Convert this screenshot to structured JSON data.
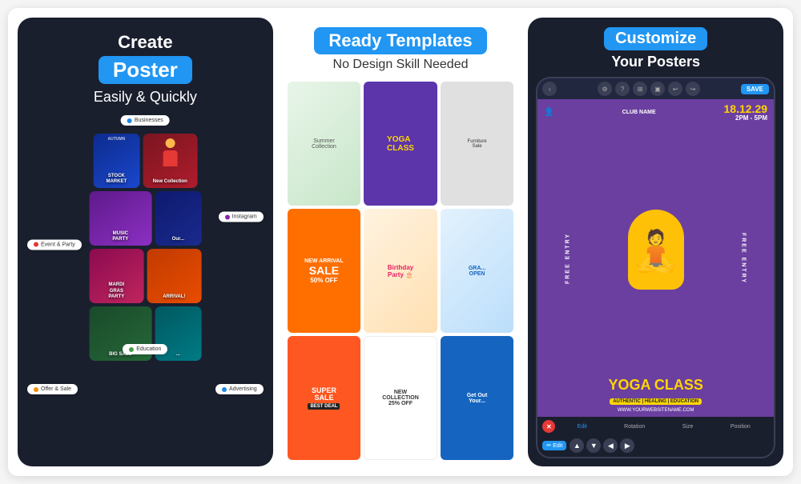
{
  "panels": {
    "panel1": {
      "create_label": "Create",
      "poster_label": "Poster",
      "easily_label": "Easily & Quickly",
      "pills": {
        "businesses": "Businesses",
        "event_party": "Event & Party",
        "instagram": "Instagram",
        "education": "Education",
        "offer_sale": "Offer & Sale",
        "advertising": "Advertising"
      },
      "cards": [
        {
          "label": "MUSIC PARTY",
          "sub": ""
        },
        {
          "label": "STOCK MARKET",
          "sub": ""
        },
        {
          "label": "New Collection",
          "sub": ""
        },
        {
          "label": "MARDI GRAS PARTY",
          "sub": ""
        },
        {
          "label": "Our...",
          "sub": ""
        },
        {
          "label": "ARRIVAL!",
          "sub": ""
        },
        {
          "label": "BIG SALE",
          "sub": ""
        }
      ]
    },
    "panel2": {
      "ready_label": "Ready Templates",
      "no_design_label": "No Design Skill Needed",
      "templates": [
        {
          "label": "YOGA CLASS",
          "bg": "purple"
        },
        {
          "label": "SALE",
          "bg": "orange"
        },
        {
          "label": "Birthday Party",
          "bg": "pink"
        },
        {
          "label": "SUPER SALE",
          "bg": "red"
        },
        {
          "label": "NEW COLLECTION 25% OFF",
          "bg": "white"
        },
        {
          "label": "GRAND OPENING",
          "bg": "dark-blue"
        },
        {
          "label": "Furniture Sale",
          "bg": "light"
        },
        {
          "label": "NEW ARRIVAL",
          "bg": "beige"
        },
        {
          "label": "Get Out Your...",
          "bg": "blue"
        }
      ]
    },
    "panel3": {
      "customize_label": "Customize",
      "your_posters_label": "Your Posters",
      "poster": {
        "club_name": "CLUB NAME",
        "date": "18.12.29",
        "time": "2PM - 5PM",
        "free_entry": "FREE ENTRY",
        "yoga_class": "YOGA CLASS",
        "tagline": "AUTHENTIC | HEALING | EDUCATION",
        "website": "WWW.YOURWEBSITENAME.COM"
      },
      "toolbar": {
        "save_label": "SAVE"
      },
      "bottom_tabs": [
        "Edit",
        "Rotation",
        "Size",
        "Position"
      ],
      "edit_label": "Edit",
      "arrows": [
        "▲",
        "▼",
        "◀",
        "▶"
      ]
    }
  }
}
